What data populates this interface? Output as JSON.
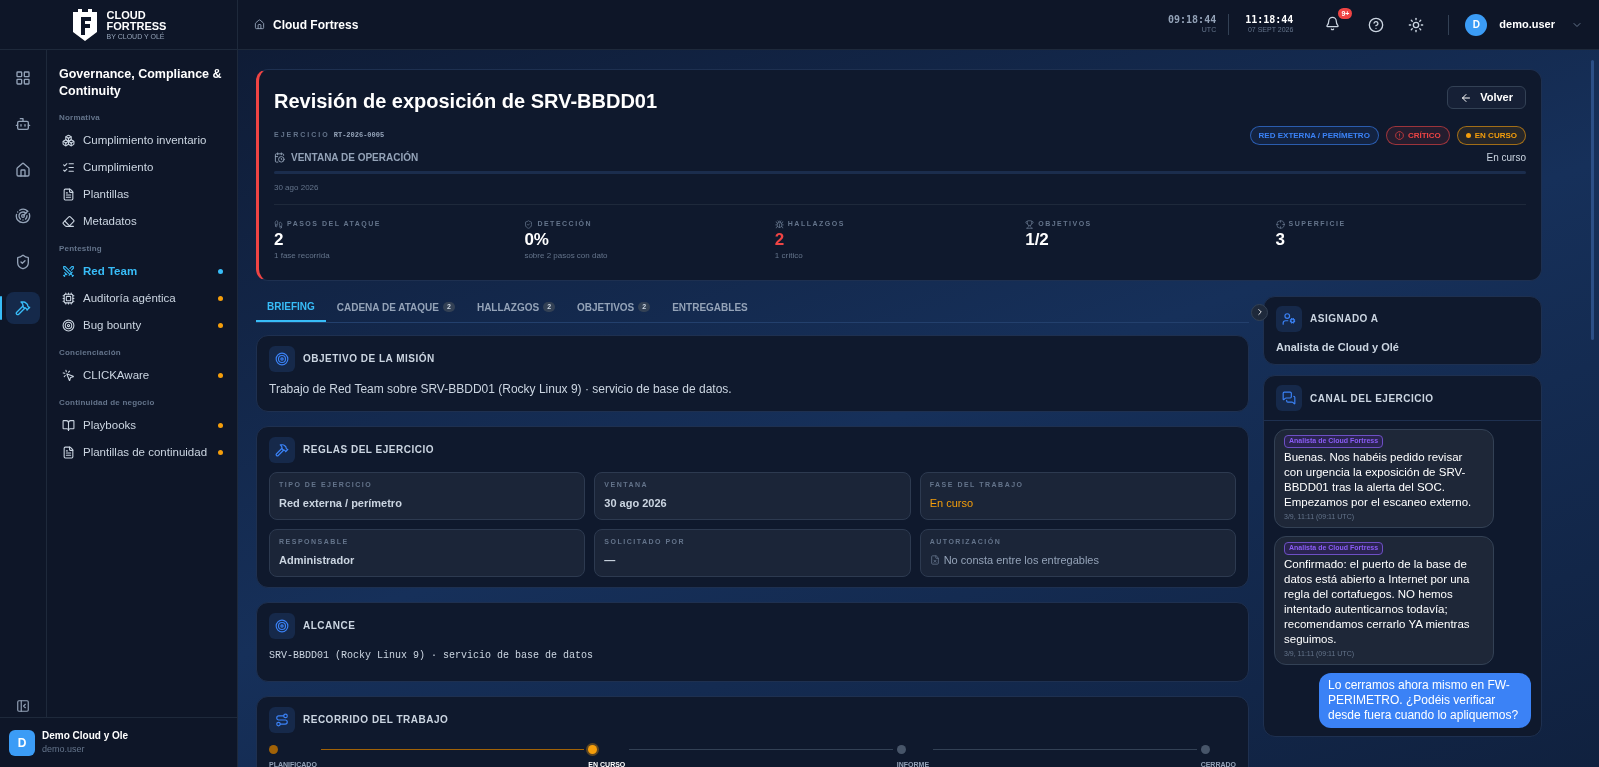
{
  "brand": {
    "line1": "CLOUD",
    "line2": "FORTRESS",
    "tagline": "BY CLOUD Y OLÉ"
  },
  "rail": [
    {
      "selected": false
    },
    {
      "selected": false
    },
    {
      "selected": false
    },
    {
      "selected": false
    },
    {
      "selected": false
    },
    {
      "selected": true
    }
  ],
  "nav": {
    "title": "Governance, Compliance & Continuity",
    "sections": [
      {
        "heading": "Normativa",
        "items": [
          {
            "label": "Cumplimiento inventario",
            "selected": false
          },
          {
            "label": "Cumplimiento",
            "selected": false
          },
          {
            "label": "Plantillas",
            "selected": false
          },
          {
            "label": "Metadatos",
            "selected": false
          }
        ]
      },
      {
        "heading": "Pentesting",
        "items": [
          {
            "label": "Red Team",
            "selected": true,
            "color": "#38bdf8"
          },
          {
            "label": "Auditoría agéntica",
            "selected": false,
            "color": "#f59e0b"
          },
          {
            "label": "Bug bounty",
            "selected": false,
            "color": "#f59e0b"
          }
        ]
      },
      {
        "heading": "Concienciación",
        "items": [
          {
            "label": "CLICKAware",
            "selected": false,
            "color": "#f59e0b"
          }
        ]
      },
      {
        "heading": "Continuidad de negocio",
        "items": [
          {
            "label": "Playbooks",
            "selected": false,
            "color": "#f59e0b"
          },
          {
            "label": "Plantillas de continuidad",
            "selected": false,
            "color": "#f59e0b"
          }
        ]
      }
    ]
  },
  "account": {
    "initial": "D",
    "name": "Demo Cloud y Ole",
    "login": "demo.user"
  },
  "topbar": {
    "breadcrumb": "Cloud Fortress",
    "utc_time": "09:18:44",
    "utc_label": "UTC",
    "local_time": "11:18:44",
    "local_date": "07 SEPT 2026",
    "notifications": "9+",
    "user_initial": "D",
    "user_name": "demo.user"
  },
  "header": {
    "title": "Revisión de exposición de SRV-BBDD01",
    "exercise_label": "EJERCICIO",
    "exercise_id": "RT-2026-0005",
    "back_button": "Volver",
    "tags": [
      {
        "label": "RED EXTERNA / PERÍMETRO",
        "kind": "plain",
        "color": "#3b82f6"
      },
      {
        "label": "CRÍTICO",
        "kind": "alert",
        "color": "#ef4444"
      },
      {
        "label": "EN CURSO",
        "kind": "dot",
        "color": "#f59e0b"
      }
    ],
    "window_label": "VENTANA DE OPERACIÓN",
    "window_status": "En curso",
    "window_date": "30 ago 2026",
    "stats": [
      {
        "label": "PASOS DEL ATAQUE",
        "value": "2",
        "note": "1 fase recorrida",
        "alert": false
      },
      {
        "label": "DETECCIÓN",
        "value": "0%",
        "note": "sobre 2 pasos con dato",
        "alert": false
      },
      {
        "label": "HALLAZGOS",
        "value": "2",
        "note": "1 crítico",
        "alert": true
      },
      {
        "label": "OBJETIVOS",
        "value": "1/2",
        "alert": false
      },
      {
        "label": "SUPERFICIE",
        "value": "3",
        "alert": false
      }
    ]
  },
  "tabs": [
    {
      "label": "BRIEFING",
      "selected": true
    },
    {
      "label": "CADENA DE ATAQUE",
      "count": "2",
      "selected": false
    },
    {
      "label": "HALLAZGOS",
      "count": "2",
      "selected": false
    },
    {
      "label": "OBJETIVOS",
      "count": "2",
      "selected": false
    },
    {
      "label": "ENTREGABLES",
      "selected": false
    }
  ],
  "mission": {
    "title": "OBJETIVO DE LA MISIÓN",
    "text": "Trabajo de Red Team sobre SRV-BBDD01 (Rocky Linux 9) · servicio de base de datos."
  },
  "rules": {
    "title": "REGLAS DEL EJERCICIO",
    "fields": [
      {
        "label": "TIPO DE EJERCICIO",
        "value": "Red externa / perímetro",
        "kind": "text"
      },
      {
        "label": "VENTANA",
        "value": "30 ago 2026",
        "kind": "text"
      },
      {
        "label": "FASE DEL TRABAJO",
        "value": "En curso",
        "kind": "status"
      },
      {
        "label": "RESPONSABLE",
        "value": "Administrador",
        "kind": "text"
      },
      {
        "label": "SOLICITADO POR",
        "value": "—",
        "kind": "text"
      },
      {
        "label": "AUTORIZACIÓN",
        "value": "No consta entre los entregables",
        "kind": "missing"
      }
    ]
  },
  "scope": {
    "title": "ALCANCE",
    "text": "SRV-BBDD01 (Rocky Linux 9) · servicio de base de datos"
  },
  "journey": {
    "title": "RECORRIDO DEL TRABAJO",
    "steps": [
      {
        "label": "PLANIFICADO",
        "done": true,
        "current": false
      },
      {
        "label": "EN CURSO",
        "done": false,
        "current": true
      },
      {
        "label": "INFORME",
        "done": false,
        "current": false
      },
      {
        "label": "CERRADO",
        "done": false,
        "current": false
      }
    ]
  },
  "assigned": {
    "title": "ASIGNADO A",
    "value": "Analista de Cloud y Olé"
  },
  "channel": {
    "title": "CANAL DEL EJERCICIO",
    "messages": [
      {
        "author": "Analista de Cloud Fortress",
        "text": "Buenas. Nos habéis pedido revisar con urgencia la exposición de SRV-BBDD01 tras la alerta del SOC. Empezamos por el escaneo externo.",
        "time": "3/9, 11:11 (09:11 UTC)",
        "mine": false
      },
      {
        "author": "Analista de Cloud Fortress",
        "text": "Confirmado: el puerto de la base de datos está abierto a Internet por una regla del cortafuegos. NO hemos intentado autenticarnos todavía; recomendamos cerrarlo YA mientras seguimos.",
        "time": "3/9, 11:11 (09:11 UTC)",
        "mine": false
      },
      {
        "text": "Lo cerramos ahora mismo en FW-PERIMETRO. ¿Podéis verificar desde fuera cuando lo apliquemos?",
        "mine": true
      }
    ]
  }
}
